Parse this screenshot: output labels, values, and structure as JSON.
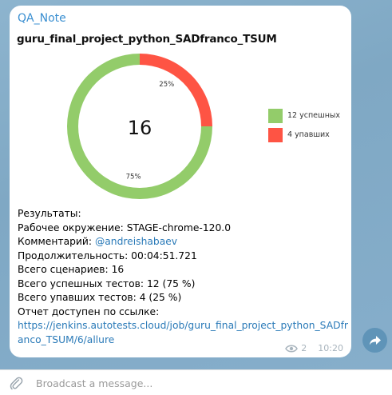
{
  "message": {
    "sender": "QA_Note",
    "chart_title": "guru_final_project_python_SADfranco_TSUM",
    "results_heading": "Результаты:",
    "environment_label": "Рабочее окружение:",
    "environment_value": "STAGE-chrome-120.0",
    "comment_label": "Комментарий:",
    "comment_mention": "@andreishabaev",
    "duration_label": "Продолжительность:",
    "duration_value": "00:04:51.721",
    "total_label": "Всего сценариев:",
    "total_value": "16",
    "passed_label": "Всего успешных тестов:",
    "passed_value": "12 (75 %)",
    "failed_label": "Всего упавших тестов:",
    "failed_value": "4 (25 %)",
    "report_label": "Отчет доступен по ссылке:",
    "report_url": "https://jenkins.autotests.cloud/job/guru_final_project_python_SADfranco_TSUM/6/allure",
    "views": "2",
    "time": "10:20"
  },
  "chart_data": {
    "type": "pie",
    "title": "guru_final_project_python_SADfranco_TSUM",
    "center_label": "16",
    "series": [
      {
        "name": "12 успешных",
        "value": 12,
        "percent_label": "75%",
        "color": "#93cc6a"
      },
      {
        "name": "4 упавших",
        "value": 4,
        "percent_label": "25%",
        "color": "#fe5444"
      }
    ],
    "legend": "right"
  },
  "composer": {
    "placeholder": "Broadcast a message..."
  },
  "icons": {
    "attach": "paperclip-icon",
    "share": "share-arrow-icon",
    "views": "eye-icon"
  }
}
